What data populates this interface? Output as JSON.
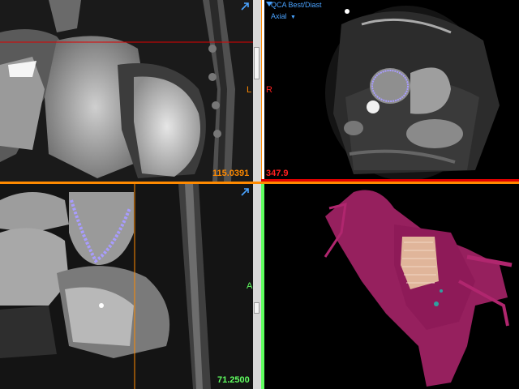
{
  "viewports": {
    "top_left": {
      "value": "115.0391",
      "orient_left": "L",
      "orient_right": "R",
      "border_color": "#ff0000",
      "value_color": "#ff8a00"
    },
    "top_right": {
      "title": "QCA Best/Diast",
      "series": "Axial",
      "value": "347.9",
      "border_color": "#ffffff",
      "value_color": "#ff2020"
    },
    "bottom_left": {
      "value": "71.2500",
      "orient_right": "A",
      "value_color": "#60ff60"
    },
    "bottom_right": {
      "description": "3D volume rendering"
    }
  },
  "icons": {
    "maximize": "diagonal-arrow-icon",
    "dropdown": "chevron-down-icon"
  },
  "colors": {
    "crosshair_red": "#e00000",
    "crosshair_orange": "#ff8a00",
    "crosshair_green": "#60ff60",
    "contour": "#a89cff",
    "volume": "#b0266e"
  }
}
